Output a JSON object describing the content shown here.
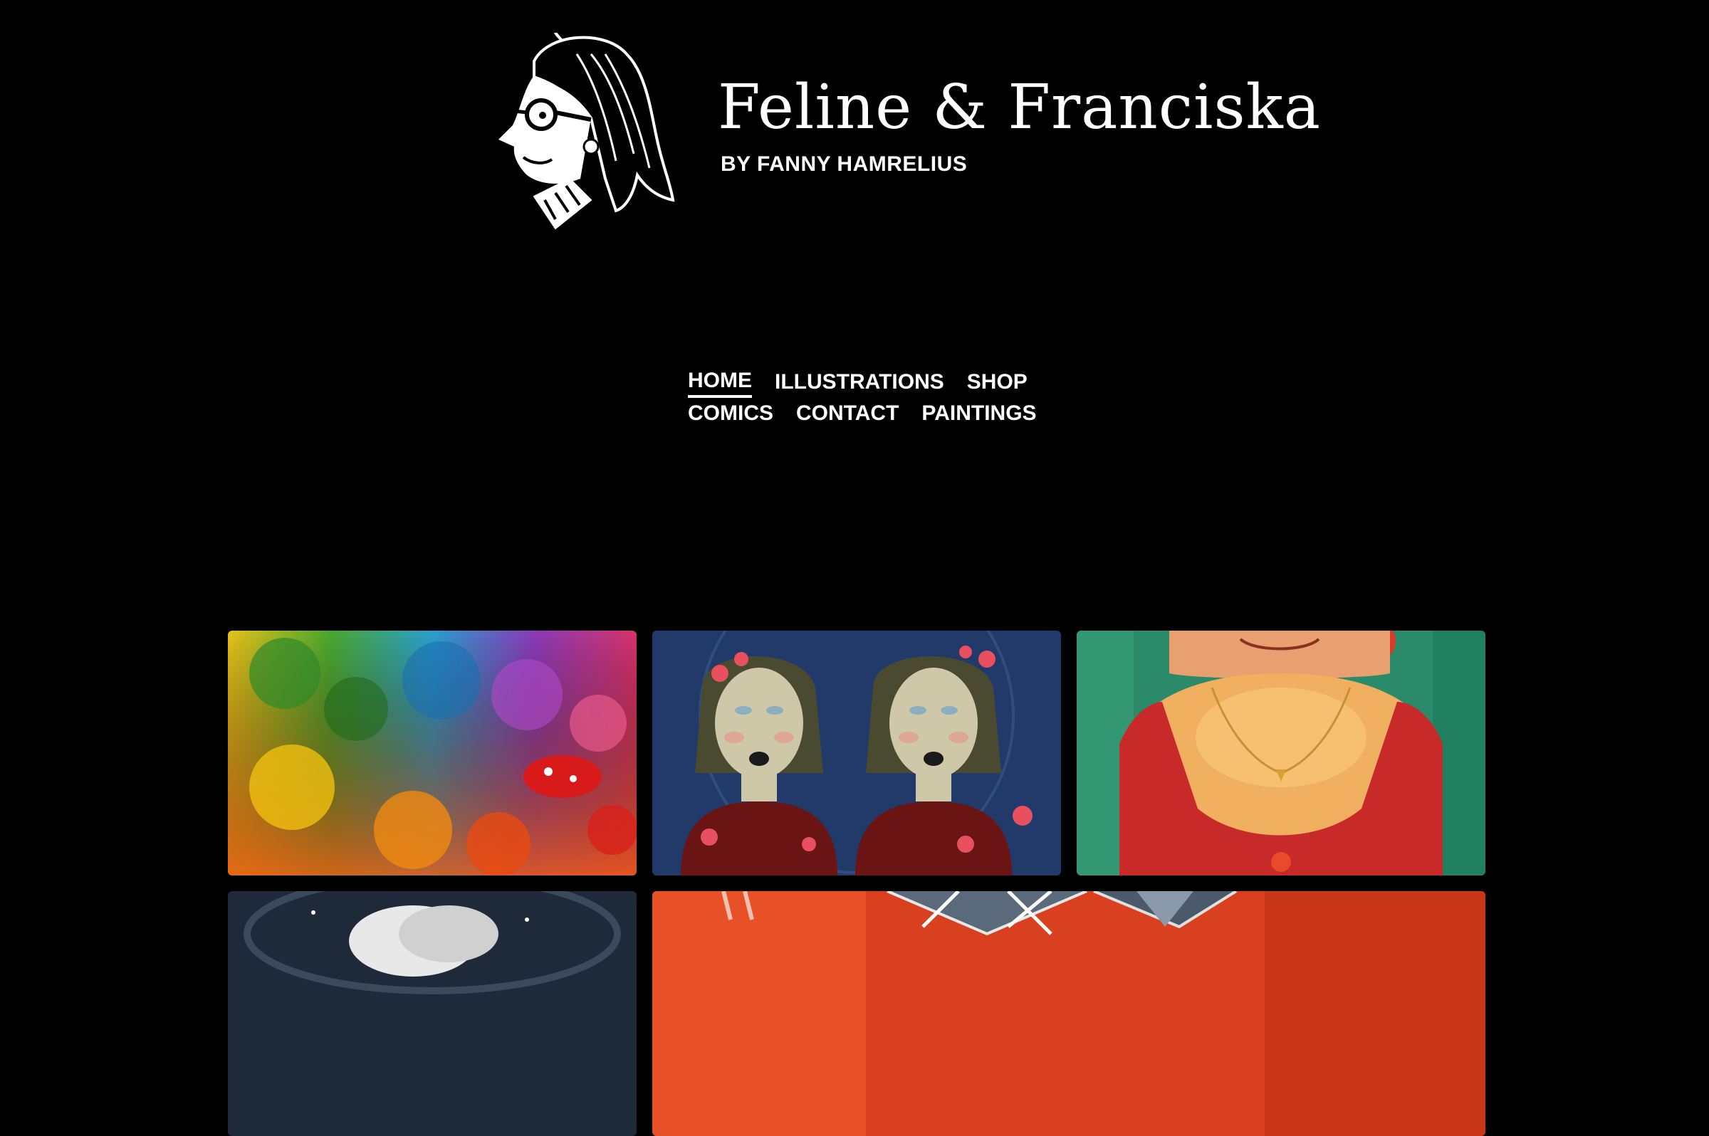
{
  "header": {
    "title": "Feline & Franciska",
    "subtitle": "BY FANNY HAMRELIUS"
  },
  "nav": {
    "row1": [
      {
        "label": "HOME",
        "active": true
      },
      {
        "label": "ILLUSTRATIONS",
        "active": false
      },
      {
        "label": "SHOP",
        "active": false
      }
    ],
    "row2": [
      {
        "label": "COMICS",
        "active": false
      },
      {
        "label": "CONTACT",
        "active": false
      },
      {
        "label": "PAINTINGS",
        "active": false
      }
    ]
  },
  "gallery": {
    "tiles": [
      {
        "subject": "rainbow-creatures-illustration"
      },
      {
        "subject": "twin-girls-illustration"
      },
      {
        "subject": "woman-red-dress-illustration"
      },
      {
        "subject": "dark-blue-illustration"
      },
      {
        "subject": "red-wings-illustration"
      }
    ]
  },
  "colors": {
    "background": "#000000",
    "text": "#ffffff"
  }
}
